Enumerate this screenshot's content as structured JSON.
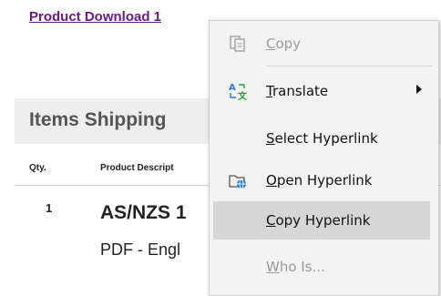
{
  "page": {
    "download_link": "Product Download 1",
    "section_title": "Items Shipping",
    "columns": {
      "qty": "Qty.",
      "description": "Product Descript"
    },
    "row": {
      "qty": "1",
      "title": "AS/NZS 1",
      "subtitle": "PDF - Engl"
    }
  },
  "menu": {
    "items": [
      {
        "first": "C",
        "rest": "opy",
        "icon": "copy-icon",
        "enabled": false
      },
      {
        "first": "T",
        "rest": "ranslate",
        "icon": "translate-icon",
        "enabled": true,
        "submenu": true
      },
      {
        "first": "S",
        "rest": "elect Hyperlink",
        "icon": "",
        "enabled": true
      },
      {
        "first": "O",
        "rest": "pen Hyperlink",
        "icon": "open-hyperlink-icon",
        "enabled": true
      },
      {
        "first": "C",
        "rest": "opy Hyperlink",
        "icon": "",
        "enabled": true,
        "highlighted": true
      },
      {
        "first": "W",
        "rest": "ho Is...",
        "icon": "",
        "enabled": false
      }
    ]
  },
  "colors": {
    "link": "#6a1b8a",
    "menu_bg": "#f3f3f3",
    "highlight": "#d6d6d6"
  }
}
